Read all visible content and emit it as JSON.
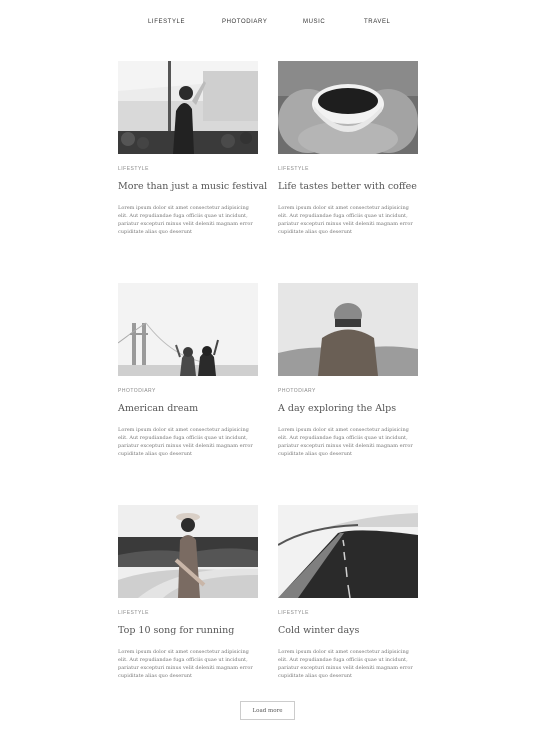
{
  "nav": {
    "items": [
      "LIFESTYLE",
      "PHOTODIARY",
      "MUSIC",
      "TRAVEL"
    ]
  },
  "posts": [
    {
      "category": "LIFESTYLE",
      "title": "More than just a music festival",
      "excerpt": "Lorem ipsum dolor sit amet consectetur adipisicing elit. Aut repudiandae fuga officiis quae ut incidunt, pariatur excepturi minus velit deleniti magnam error cupiditate alias quo deserunt"
    },
    {
      "category": "LIFESTYLE",
      "title": "Life tastes better with coffee",
      "excerpt": "Lorem ipsum dolor sit amet consectetur adipisicing elit. Aut repudiandae fuga officiis quae ut incidunt, pariatur excepturi minus velit deleniti magnam error cupiditate alias quo deserunt"
    },
    {
      "category": "PHOTODIARY",
      "title": "American dream",
      "excerpt": "Lorem ipsum dolor sit amet consectetur adipisicing elit. Aut repudiandae fuga officiis quae ut incidunt, pariatur excepturi minus velit deleniti magnam error cupiditate alias quo deserunt"
    },
    {
      "category": "PHOTODIARY",
      "title": "A day exploring the Alps",
      "excerpt": "Lorem ipsum dolor sit amet consectetur adipisicing elit. Aut repudiandae fuga officiis quae ut incidunt, pariatur excepturi minus velit deleniti magnam error cupiditate alias quo deserunt"
    },
    {
      "category": "LIFESTYLE",
      "title": "Top 10 song for running",
      "excerpt": "Lorem ipsum dolor sit amet consectetur adipisicing elit. Aut repudiandae fuga officiis quae ut incidunt, pariatur excepturi minus velit deleniti magnam error cupiditate alias quo deserunt"
    },
    {
      "category": "LIFESTYLE",
      "title": "Cold winter days",
      "excerpt": "Lorem ipsum dolor sit amet consectetur adipisicing elit. Aut repudiandae fuga officiis quae ut incidunt, pariatur excepturi minus velit deleniti magnam error cupiditate alias quo deserunt"
    }
  ],
  "load_more": {
    "label": "Load more"
  }
}
